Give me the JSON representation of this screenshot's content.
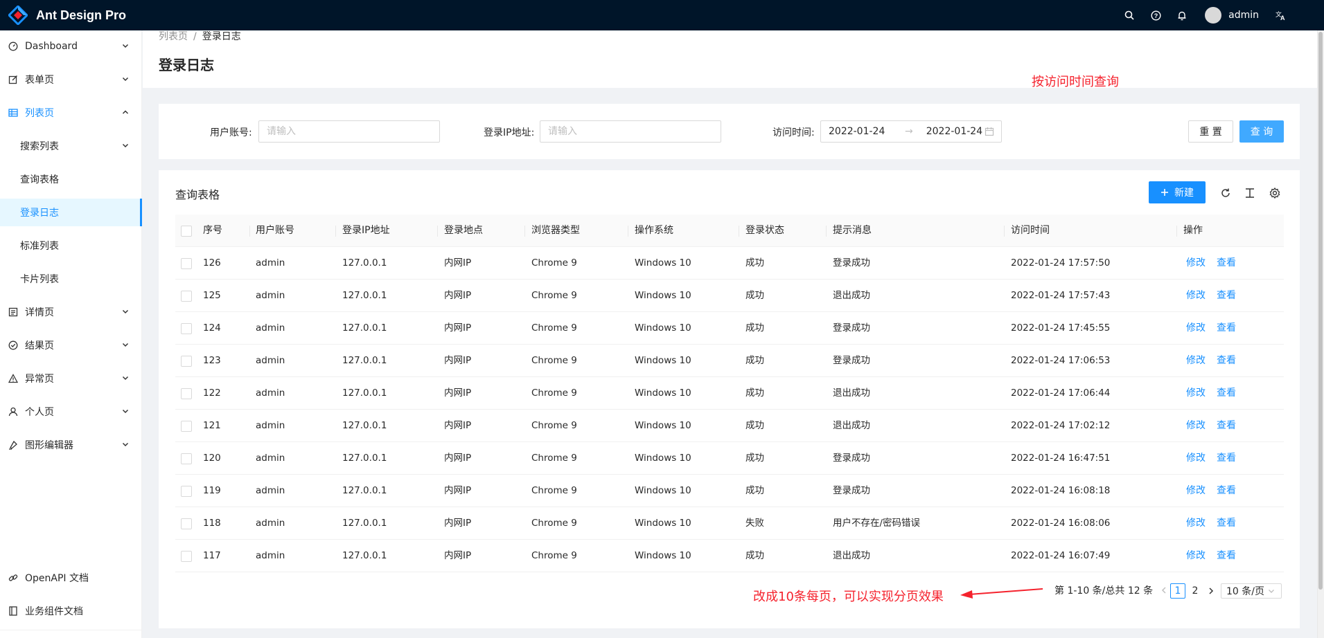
{
  "app": {
    "title": "Ant Design Pro",
    "user_name": "admin",
    "brand_color": "#1890ff",
    "header_bg": "#001529"
  },
  "header": {
    "icons": [
      "search-icon",
      "question-icon",
      "bell-icon",
      "translate-icon"
    ]
  },
  "sidebar": {
    "items": [
      {
        "label": "Dashboard",
        "icon": "dashboard-icon",
        "chevron": "down"
      },
      {
        "label": "表单页",
        "icon": "form-icon",
        "chevron": "down"
      },
      {
        "label": "列表页",
        "icon": "table-icon",
        "chevron": "up"
      },
      {
        "label": "搜索列表",
        "chevron": "down"
      },
      {
        "label": "查询表格"
      },
      {
        "label": "登录日志"
      },
      {
        "label": "标准列表"
      },
      {
        "label": "卡片列表"
      },
      {
        "label": "详情页",
        "icon": "profile-icon",
        "chevron": "down"
      },
      {
        "label": "结果页",
        "icon": "check-circle-icon",
        "chevron": "down"
      },
      {
        "label": "异常页",
        "icon": "warning-icon",
        "chevron": "down"
      },
      {
        "label": "个人页",
        "icon": "user-icon",
        "chevron": "down"
      },
      {
        "label": "图形编辑器",
        "icon": "highlight-icon",
        "chevron": "down"
      }
    ],
    "footer": [
      {
        "label": "OpenAPI 文档",
        "icon": "link-icon"
      },
      {
        "label": "业务组件文档",
        "icon": "book-icon"
      }
    ]
  },
  "breadcrumb": {
    "parent": "列表页",
    "separator": "/",
    "current": "登录日志"
  },
  "page": {
    "title": "登录日志"
  },
  "search": {
    "account_label": "用户账号:",
    "account_placeholder": "请输入",
    "ip_label": "登录IP地址:",
    "ip_placeholder": "请输入",
    "time_label": "访问时间:",
    "start_date": "2022-01-24",
    "end_date": "2022-01-24",
    "reset_label": "重 置",
    "query_label": "查 询"
  },
  "annotations": {
    "time_query": "按访问时间查询",
    "pagination": "改成10条每页，可以实现分页效果"
  },
  "table": {
    "title": "查询表格",
    "new_label": "新建",
    "columns": [
      "序号",
      "用户账号",
      "登录IP地址",
      "登录地点",
      "浏览器类型",
      "操作系统",
      "登录状态",
      "提示消息",
      "访问时间",
      "操作"
    ],
    "action_edit": "修改",
    "action_view": "查看",
    "rows": [
      [
        "126",
        "admin",
        "127.0.0.1",
        "内网IP",
        "Chrome 9",
        "Windows 10",
        "成功",
        "登录成功",
        "2022-01-24 17:57:50"
      ],
      [
        "125",
        "admin",
        "127.0.0.1",
        "内网IP",
        "Chrome 9",
        "Windows 10",
        "成功",
        "退出成功",
        "2022-01-24 17:57:43"
      ],
      [
        "124",
        "admin",
        "127.0.0.1",
        "内网IP",
        "Chrome 9",
        "Windows 10",
        "成功",
        "登录成功",
        "2022-01-24 17:45:55"
      ],
      [
        "123",
        "admin",
        "127.0.0.1",
        "内网IP",
        "Chrome 9",
        "Windows 10",
        "成功",
        "登录成功",
        "2022-01-24 17:06:53"
      ],
      [
        "122",
        "admin",
        "127.0.0.1",
        "内网IP",
        "Chrome 9",
        "Windows 10",
        "成功",
        "退出成功",
        "2022-01-24 17:06:44"
      ],
      [
        "121",
        "admin",
        "127.0.0.1",
        "内网IP",
        "Chrome 9",
        "Windows 10",
        "成功",
        "退出成功",
        "2022-01-24 17:02:12"
      ],
      [
        "120",
        "admin",
        "127.0.0.1",
        "内网IP",
        "Chrome 9",
        "Windows 10",
        "成功",
        "登录成功",
        "2022-01-24 16:47:51"
      ],
      [
        "119",
        "admin",
        "127.0.0.1",
        "内网IP",
        "Chrome 9",
        "Windows 10",
        "成功",
        "登录成功",
        "2022-01-24 16:08:18"
      ],
      [
        "118",
        "admin",
        "127.0.0.1",
        "内网IP",
        "Chrome 9",
        "Windows 10",
        "失败",
        "用户不存在/密码错误",
        "2022-01-24 16:08:06"
      ],
      [
        "117",
        "admin",
        "127.0.0.1",
        "内网IP",
        "Chrome 9",
        "Windows 10",
        "成功",
        "退出成功",
        "2022-01-24 16:07:49"
      ]
    ]
  },
  "pagination": {
    "total_text": "第 1-10 条/总共 12 条",
    "pages": [
      "1",
      "2"
    ],
    "current": "1",
    "page_size": "10 条/页"
  }
}
